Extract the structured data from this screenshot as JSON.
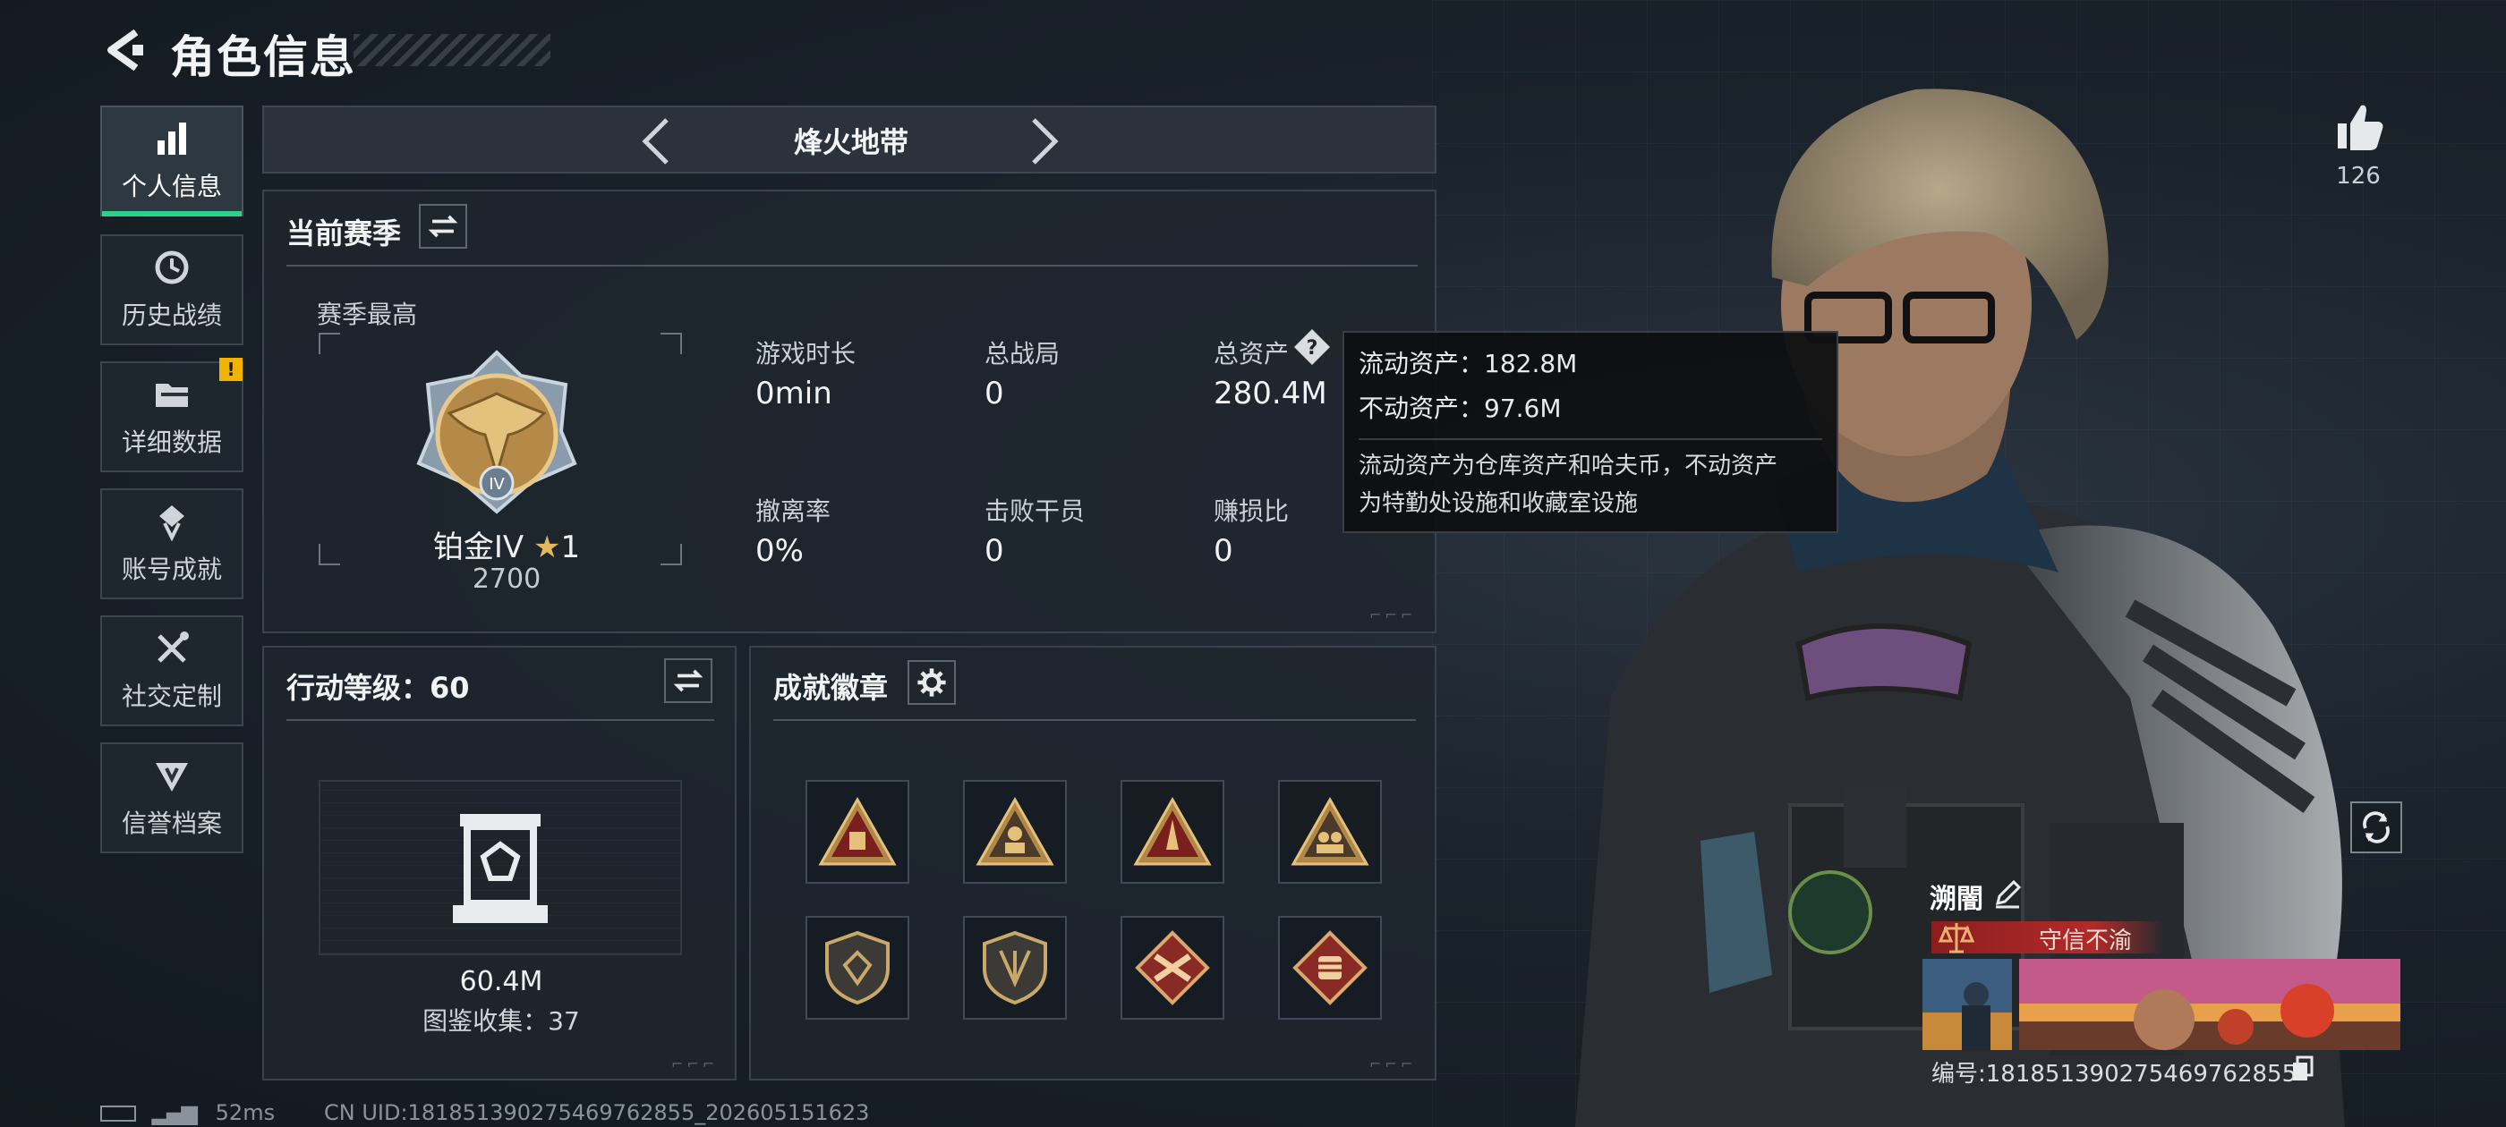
{
  "header": {
    "title": "角色信息"
  },
  "sidebar": {
    "items": [
      {
        "label": "个人信息",
        "icon": "bar-chart-icon",
        "active": true
      },
      {
        "label": "历史战绩",
        "icon": "history-clock-icon"
      },
      {
        "label": "详细数据",
        "icon": "folder-icon",
        "badge": "!"
      },
      {
        "label": "账号成就",
        "icon": "achievement-icon"
      },
      {
        "label": "社交定制",
        "icon": "tools-icon"
      },
      {
        "label": "信誉档案",
        "icon": "reputation-shield-icon"
      }
    ]
  },
  "mode": {
    "title": "烽火地带"
  },
  "season": {
    "title": "当前赛季",
    "best_label": "赛季最高",
    "rank_name": "铂金IV",
    "rank_stars": "1",
    "rank_score": "2700",
    "emblem_numeral": "IV",
    "stats": [
      {
        "label": "游戏时长",
        "value": "0min"
      },
      {
        "label": "总战局",
        "value": "0"
      },
      {
        "label": "总资产",
        "value": "280.4M",
        "has_help": true
      },
      {
        "label": "撤离率",
        "value": "0%"
      },
      {
        "label": "击败干员",
        "value": "0"
      },
      {
        "label": "赚损比",
        "value": "0"
      }
    ]
  },
  "tooltip": {
    "liquid": "流动资产：182.8M",
    "fixed": "不动资产：97.6M",
    "desc_1": "流动资产为仓库资产和哈夫币，不动资产",
    "desc_2": "为特勤处设施和收藏室设施"
  },
  "action_level": {
    "title": "行动等级：60",
    "value": "60.4M",
    "collection": "图鉴收集：37"
  },
  "badges": {
    "title": "成就徽章",
    "items": [
      "supply-triangle-badge",
      "soldier-triangle-badge",
      "rocket-triangle-badge",
      "squad-triangle-badge",
      "shield-emblem-badge",
      "wing-shield-badge",
      "crossed-weapons-badge",
      "fist-diamond-badge"
    ]
  },
  "profile": {
    "likes": "126",
    "name": "溯闇",
    "title_tag": "守信不渝",
    "player_id": "编号:181851390275469762855"
  },
  "status": {
    "ping": "52ms",
    "uid": "CN UID:181851390275469762855_202605151623"
  },
  "colors": {
    "accent_green": "#2fd08a",
    "warning_yellow": "#f0b400",
    "title_red": "#b22a2a"
  }
}
